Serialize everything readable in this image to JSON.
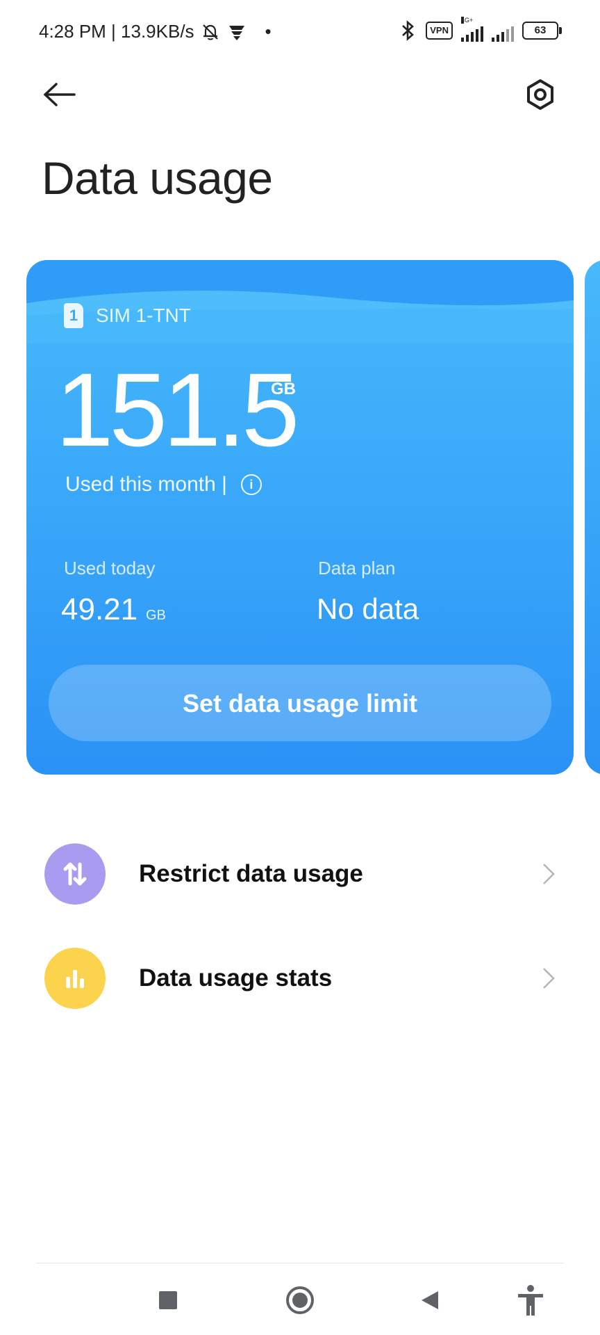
{
  "status_bar": {
    "time_speed": "4:28 PM | 13.9KB/s",
    "vpn": "VPN",
    "network_type": "4G+",
    "battery": "63"
  },
  "header": {
    "title": "Data usage"
  },
  "card": {
    "sim_number": "1",
    "sim_label": "SIM 1-TNT",
    "used_month_value": "151.5",
    "used_month_unit": "GB",
    "used_month_label": "Used this month |",
    "used_today_label": "Used today",
    "used_today_value": "49.21",
    "used_today_unit": "GB",
    "data_plan_label": "Data plan",
    "data_plan_value": "No data",
    "limit_button": "Set data usage limit"
  },
  "list": [
    {
      "label": "Restrict data usage",
      "icon": "arrows-updown-icon",
      "color": "#a99cf0"
    },
    {
      "label": "Data usage stats",
      "icon": "bar-chart-icon",
      "color": "#fcd34d"
    }
  ],
  "colors": {
    "card_top": "#47b9fb",
    "card_bottom": "#2a92f5"
  }
}
